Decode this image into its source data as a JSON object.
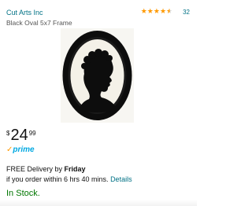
{
  "header": {
    "brand": "Cut Arts Inc",
    "review_count": "32",
    "rating_stars": 4.5
  },
  "product": {
    "title": "Black Oval 5x7 Frame"
  },
  "price": {
    "currency": "$",
    "whole": "24",
    "fraction": "99"
  },
  "prime": {
    "check": "✓",
    "label": "prime"
  },
  "delivery": {
    "prefix": "FREE Delivery by ",
    "day": "Friday",
    "line2": "if you order within 6 hrs 40 mins. ",
    "details_label": "Details"
  },
  "stock": {
    "label": "In Stock."
  },
  "colors": {
    "link": "#007185",
    "star": "#ff9900",
    "stock": "#007600",
    "prime": "#00a8e1"
  }
}
